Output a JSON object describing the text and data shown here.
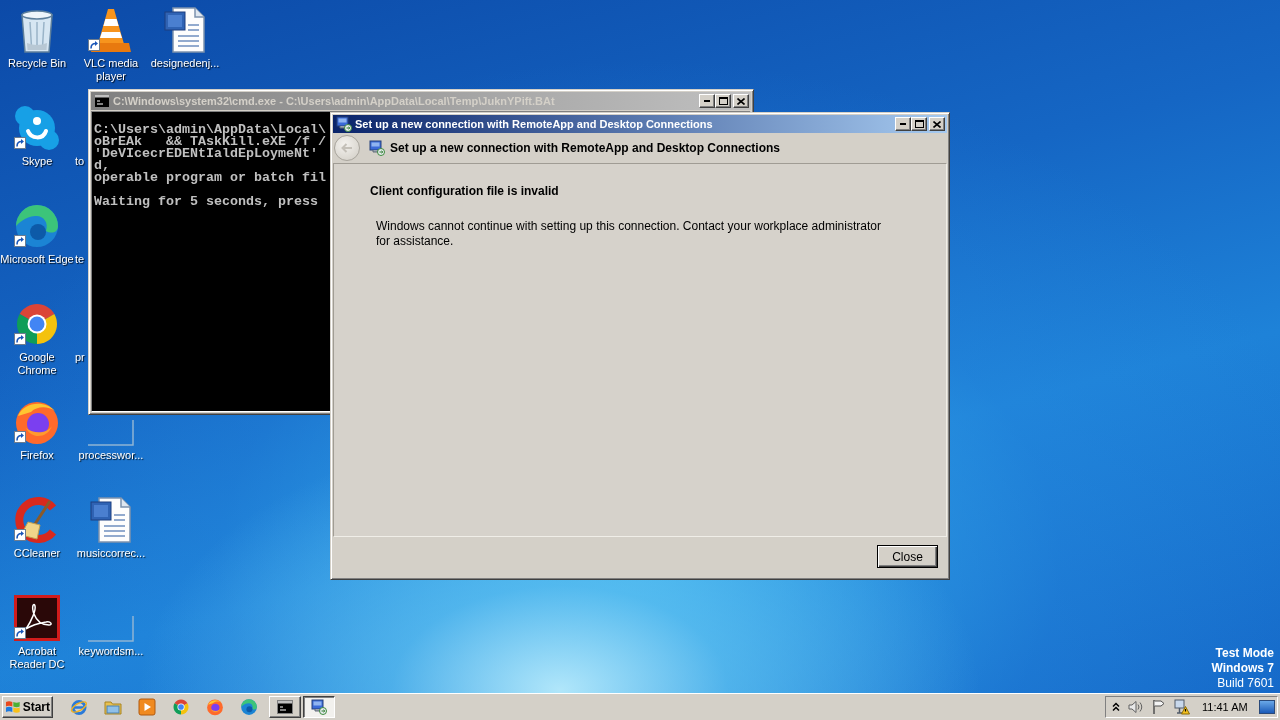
{
  "desktop": {
    "columns": [
      {
        "icons": [
          {
            "label": "Recycle Bin",
            "kind": "recycle-bin",
            "shortcut": false
          },
          {
            "label": "Skype",
            "kind": "skype",
            "shortcut": true
          },
          {
            "label": "Microsoft Edge",
            "kind": "edge",
            "shortcut": true
          },
          {
            "label": "Google Chrome",
            "kind": "chrome",
            "shortcut": true
          },
          {
            "label": "Firefox",
            "kind": "firefox",
            "shortcut": true
          },
          {
            "label": "CCleaner",
            "kind": "ccleaner",
            "shortcut": true
          },
          {
            "label": "Acrobat Reader DC",
            "kind": "acrobat",
            "shortcut": true
          }
        ]
      },
      {
        "icons": [
          {
            "label": "VLC media player",
            "kind": "vlc",
            "shortcut": true
          },
          {
            "label": "to",
            "kind": "covered"
          },
          {
            "label": "te",
            "kind": "covered"
          },
          {
            "label": "pr",
            "kind": "covered"
          },
          {
            "label": "processwor...",
            "kind": "blank-file",
            "shortcut": false
          },
          {
            "label": "musiccorrec...",
            "kind": "word-doc",
            "shortcut": false
          },
          {
            "label": "keywordsm...",
            "kind": "blank-file",
            "shortcut": false
          }
        ]
      },
      {
        "icons": [
          {
            "label": "designedenj...",
            "kind": "word-doc",
            "shortcut": false
          }
        ]
      }
    ],
    "notice": [
      {
        "text": "Test Mode",
        "bold": true
      },
      {
        "text": "Windows 7",
        "bold": true
      },
      {
        "text": "Build 7601",
        "bold": false
      }
    ]
  },
  "console_window": {
    "title": "C:\\Windows\\system32\\cmd.exe - C:\\Users\\admin\\AppData\\Local\\Temp\\JuknYPift.BAt",
    "active": false,
    "output_blocks": [
      [
        "C:\\Users\\admin\\AppData\\Local\\",
        "oBrEAk   && TAskKill.eXE /f /",
        "'DeVIcecrEDENtIaldEpLoymeNt'",
        "d,",
        "operable program or batch fil"
      ],
      [
        "Waiting for 5 seconds, press"
      ]
    ]
  },
  "dialog": {
    "title": "Set up a new connection with RemoteApp and Desktop Connections",
    "active": true,
    "back_button": {
      "disabled": true
    },
    "header": "Set up a new connection with RemoteApp and Desktop Connections",
    "heading": "Client configuration file is invalid",
    "message": "Windows cannot continue with setting up this connection. Contact your workplace administrator for assistance.",
    "buttons": [
      {
        "label": "Close"
      }
    ]
  },
  "taskbar": {
    "start": {
      "label": "Start"
    },
    "tasks": [
      {
        "kind": "console",
        "selected": false
      },
      {
        "kind": "remote-desktop",
        "selected": true
      }
    ],
    "clock": "11:41 AM"
  }
}
